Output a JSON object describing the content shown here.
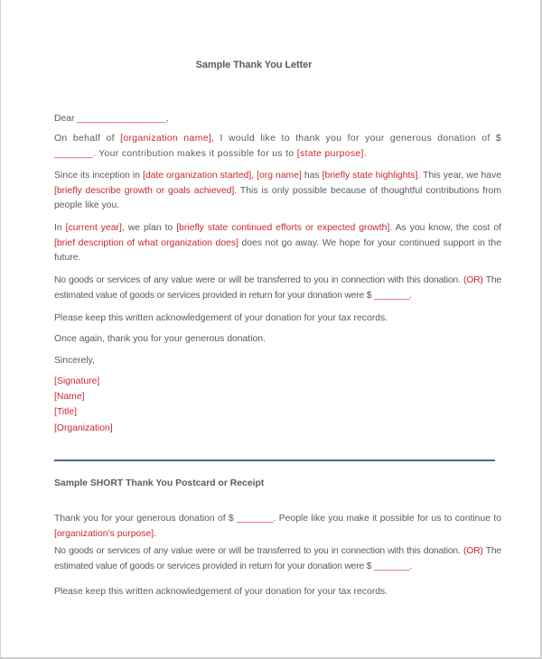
{
  "document": {
    "title": "Sample Thank You Letter",
    "letter": {
      "greeting": {
        "prefix": "Dear ",
        "blank": "_________________",
        "suffix": ","
      },
      "paragraph1": [
        {
          "t": "On behalf of ",
          "ph": false
        },
        {
          "t": "[organization name]",
          "ph": true
        },
        {
          "t": ", I would like to thank you for your generous donation of $ ",
          "ph": false
        },
        {
          "t": "_______",
          "ph": true
        },
        {
          "t": ". Your contribution makes it possible for us to ",
          "ph": false
        },
        {
          "t": "[state purpose]",
          "ph": true
        },
        {
          "t": ".",
          "ph": false
        }
      ],
      "paragraph2": [
        {
          "t": "Since its inception in ",
          "ph": false
        },
        {
          "t": "[date organization started]",
          "ph": true
        },
        {
          "t": ", ",
          "ph": false
        },
        {
          "t": "[org name]",
          "ph": true
        },
        {
          "t": " has ",
          "ph": false
        },
        {
          "t": "[briefly state highlights]",
          "ph": true
        },
        {
          "t": ". This year, we have ",
          "ph": false
        },
        {
          "t": "[briefly describe growth or goals achieved]",
          "ph": true
        },
        {
          "t": ". This is only possible because of thoughtful contributions from people like you.",
          "ph": false
        }
      ],
      "paragraph3": [
        {
          "t": "In ",
          "ph": false
        },
        {
          "t": "[current year]",
          "ph": true
        },
        {
          "t": ", we plan to ",
          "ph": false
        },
        {
          "t": "[briefly state continued efforts or expected growth]",
          "ph": true
        },
        {
          "t": ". As you know, the cost of ",
          "ph": false
        },
        {
          "t": "[brief description of what organization does]",
          "ph": true
        },
        {
          "t": " does not go away. We hope for your continued support in the future.",
          "ph": false
        }
      ],
      "paragraph4": [
        {
          "t": "No goods or services of any value were or will be transferred to you in connection with this donation. ",
          "ph": false
        },
        {
          "t": "(OR)",
          "ph": true
        },
        {
          "t": " The estimated value of goods or services provided in return for your donation were $ ",
          "ph": false
        },
        {
          "t": "_______",
          "ph": true
        },
        {
          "t": ".",
          "ph": false
        }
      ],
      "paragraph5": "Please keep this written acknowledgement of your donation for your tax records.",
      "paragraph6": "Once again, thank you for your generous donation.",
      "closing": "Sincerely,",
      "signature_lines": [
        "[Signature]",
        "[Name]",
        "[Title]",
        "[Organization]"
      ]
    },
    "short_section": {
      "title": "Sample SHORT Thank You Postcard or Receipt",
      "paragraph1": [
        {
          "t": "Thank you for your generous donation of $ ",
          "ph": false
        },
        {
          "t": "_______",
          "ph": true
        },
        {
          "t": ". People like you make it possible for us to continue to ",
          "ph": false
        },
        {
          "t": "[organization’s purpose]",
          "ph": true
        },
        {
          "t": ".",
          "ph": false
        }
      ],
      "paragraph2": [
        {
          "t": "No goods or services of any value were or will be transferred to you in connection with this donation. ",
          "ph": false
        },
        {
          "t": "(OR)",
          "ph": true
        },
        {
          "t": " The estimated value of goods or services provided in return for your donation were $ ",
          "ph": false
        },
        {
          "t": "_______",
          "ph": true
        },
        {
          "t": ".",
          "ph": false
        }
      ],
      "paragraph3": "Please keep this written acknowledgement of your donation for your tax records."
    }
  },
  "colors": {
    "text": "#5a5a5a",
    "placeholder": "#c8282d",
    "rule": "#4b6a8c",
    "page_border": "#d0d0d0"
  }
}
